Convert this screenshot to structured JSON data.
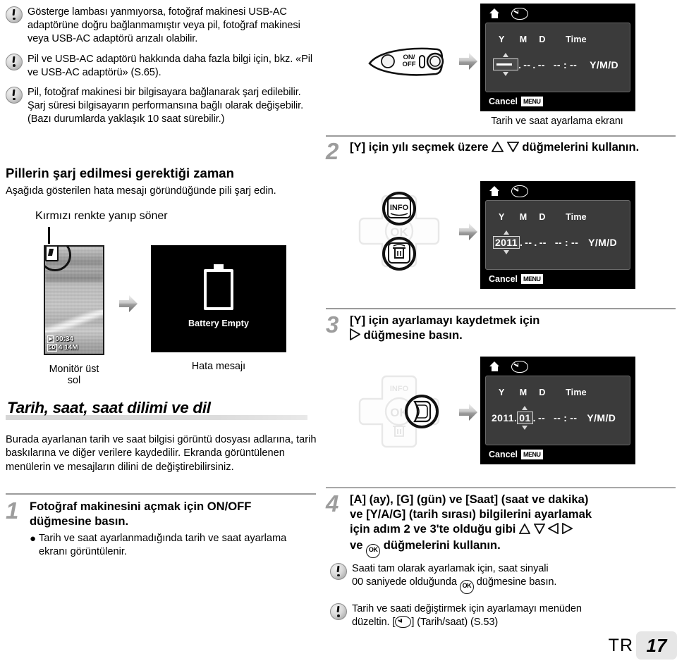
{
  "document": {
    "language_code": "TR",
    "page_number": "17"
  },
  "left_column": {
    "notes": [
      {
        "icon": "caution-icon",
        "text": "Gösterge lambası yanmıyorsa, fotoğraf makinesi USB-AC adaptörüne doğru bağlanmamıştır veya pil, fotoğraf makinesi veya USB-AC adaptörü arızalı olabilir."
      },
      {
        "icon": "caution-icon",
        "text": "Pil ve USB-AC adaptörü hakkında daha fazla bilgi için, bkz. «Pil ve USB-AC adaptörü» (S.65)."
      },
      {
        "icon": "caution-icon",
        "text": "Pil, fotoğraf makinesi bir bilgisayara bağlanarak şarj edilebilir. Şarj süresi bilgisayarın performansına bağlı olarak değişebilir. (Bazı durumlarda yaklaşık 10 saat sürebilir.)"
      }
    ],
    "charge_section": {
      "heading": "Pillerin şarj edilmesi gerektiği zaman",
      "intro": "Aşağıda gösterilen hata mesajı göründüğünde pili şarj edin.",
      "blink_label": "Kırmızı renkte yanıp söner",
      "monitor": {
        "icon": "battery-low-icon",
        "osd_time": "00:34",
        "osd_card": "SD",
        "osd_count": "4",
        "osd_size": "14M",
        "caption": "Monitör üst sol"
      },
      "error_screen": {
        "icon": "battery-empty-icon",
        "message": "Battery Empty",
        "caption": "Hata mesajı"
      },
      "arrow": "right-arrow-icon"
    },
    "datetime_section": {
      "heading": "Tarih, saat, saat dilimi ve dil",
      "paragraph": "Burada ayarlanan tarih ve saat bilgisi görüntü dosyası adlarına, tarih baskılarına ve diğer verilere kaydedilir. Ekranda görüntülenen menülerin ve mesajların dilini de değiştirebilirsiniz.",
      "step1": {
        "number": "1",
        "title": "Fotoğraf makinesini açmak için ON/OFF düğmesine basın.",
        "bullet_dot": "●",
        "bullet": "Tarih ve saat ayarlanmadığında tarih ve saat ayarlama ekranı görüntülenir."
      }
    }
  },
  "right_column": {
    "step1_figure": {
      "power_button": {
        "icon": "on-off-switch-icon",
        "label_on": "ON/",
        "label_off": "OFF"
      },
      "arrow": "right-arrow-icon",
      "lcd": {
        "home_icon": "home-icon",
        "clock_icon": "clock-icon",
        "headers": [
          "Y",
          "M",
          "D",
          "Time"
        ],
        "year": "----",
        "month": "--",
        "day": "--",
        "hour": "--",
        "minute": "--",
        "separator_dot": ".",
        "time_separator": ":",
        "order": "Y/M/D",
        "cancel_label": "Cancel",
        "menu_chip": "MENU",
        "selected_field": "year"
      },
      "caption": "Tarih ve saat ayarlama ekranı"
    },
    "step2": {
      "number": "2",
      "title_parts": {
        "before": "[Y] için yılı seçmek üzere",
        "after": "düğmelerini kullanın."
      },
      "buttons": [
        "up-triangle-icon",
        "down-triangle-icon"
      ],
      "dpad": {
        "info_label": "INFO",
        "ok_label": "OK",
        "trash_icon": "trash-icon",
        "highlight": "up-down"
      },
      "arrow": "right-arrow-icon",
      "lcd": {
        "home_icon": "home-icon",
        "clock_icon": "clock-icon",
        "headers": [
          "Y",
          "M",
          "D",
          "Time"
        ],
        "year": "2011",
        "month": "--",
        "day": "--",
        "hour": "--",
        "minute": "--",
        "separator_dot": ".",
        "time_separator": ":",
        "order": "Y/M/D",
        "cancel_label": "Cancel",
        "menu_chip": "MENU",
        "selected_field": "year"
      }
    },
    "step3": {
      "number": "3",
      "title_line1": "[Y] için ayarlamayı kaydetmek için",
      "title_line2_after": "düğmesine basın.",
      "button": "right-triangle-icon",
      "dpad": {
        "info_label": "INFO",
        "ok_label": "OK",
        "trash_icon": "trash-icon",
        "highlight": "right"
      },
      "arrow": "right-arrow-icon",
      "lcd": {
        "home_icon": "home-icon",
        "clock_icon": "clock-icon",
        "headers": [
          "Y",
          "M",
          "D",
          "Time"
        ],
        "year": "2011",
        "month": "01",
        "day": "--",
        "hour": "--",
        "minute": "--",
        "separator_dot": ".",
        "time_separator": ":",
        "order": "Y/M/D",
        "cancel_label": "Cancel",
        "menu_chip": "MENU",
        "selected_field": "month"
      }
    },
    "step4": {
      "number": "4",
      "line1": "[A] (ay), [G] (gün) ve [Saat] (saat ve dakika)",
      "line2": "ve [Y/A/G] (tarih sırası) bilgilerini ayarlamak",
      "line3": "için adım 2 ve 3'te olduğu gibi",
      "line4_after": "düğmelerini kullanın.",
      "line4_before": "ve",
      "ok_label": "OK"
    },
    "notes": [
      {
        "icon": "caution-icon",
        "line1": "Saati tam olarak ayarlamak için, saat sinyali",
        "line2_before": "00 saniyede olduğunda",
        "line2_after": "düğmesine basın.",
        "ok_label": "OK"
      },
      {
        "icon": "caution-icon",
        "line1": "Tarih ve saati değiştirmek için ayarlamayı menüden",
        "line2_before": "düzeltin. [",
        "line2_after": "] (Tarih/saat) (S.53)"
      }
    ]
  },
  "colors": {
    "page_bg": "#ffffff",
    "text": "#000000",
    "step_number": "#9d9d9d",
    "rule": "#9b9b9b",
    "banner_bar": "#d6d6d6",
    "lcd_bg": "#000000",
    "lcd_panel": "#3b3b3b",
    "page_box": "#e6e6e6"
  }
}
